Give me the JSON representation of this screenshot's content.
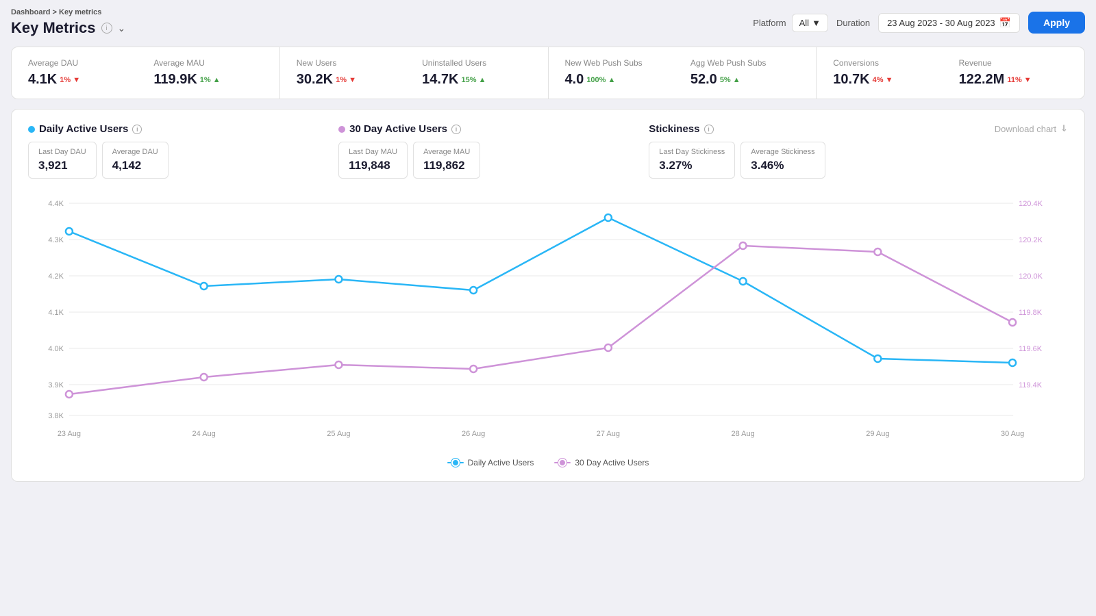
{
  "breadcrumb": {
    "parent": "Dashboard",
    "separator": ">",
    "current": "Key metrics"
  },
  "pageTitle": "Key Metrics",
  "controls": {
    "platform_label": "Platform",
    "platform_value": "All",
    "duration_label": "Duration",
    "duration_value": "23 Aug 2023 - 30 Aug 2023",
    "apply_label": "Apply"
  },
  "metrics": [
    {
      "group": "group1",
      "items": [
        {
          "label": "Average DAU",
          "value": "4.1K",
          "badge": "1%",
          "trend": "down"
        },
        {
          "label": "Average MAU",
          "value": "119.9K",
          "badge": "1%",
          "trend": "up"
        }
      ]
    },
    {
      "group": "group2",
      "items": [
        {
          "label": "New Users",
          "value": "30.2K",
          "badge": "1%",
          "trend": "down"
        },
        {
          "label": "Uninstalled Users",
          "value": "14.7K",
          "badge": "15%",
          "trend": "up"
        }
      ]
    },
    {
      "group": "group3",
      "items": [
        {
          "label": "New Web Push Subs",
          "value": "4.0",
          "badge": "100%",
          "trend": "up"
        },
        {
          "label": "Agg Web Push Subs",
          "value": "52.0",
          "badge": "5%",
          "trend": "up"
        }
      ]
    },
    {
      "group": "group4",
      "items": [
        {
          "label": "Conversions",
          "value": "10.7K",
          "badge": "4%",
          "trend": "down"
        },
        {
          "label": "Revenue",
          "value": "122.2M",
          "badge": "11%",
          "trend": "down"
        }
      ]
    }
  ],
  "chart": {
    "series1": {
      "label": "Daily Active Users",
      "dot_color": "#29b6f6",
      "last_day_label": "Last Day DAU",
      "last_day_value": "3,921",
      "average_label": "Average DAU",
      "average_value": "4,142"
    },
    "series2": {
      "label": "30 Day Active Users",
      "dot_color": "#ce93d8",
      "last_day_label": "Last Day MAU",
      "last_day_value": "119,848",
      "average_label": "Average MAU",
      "average_value": "119,862"
    },
    "stickiness": {
      "label": "Stickiness",
      "last_day_label": "Last Day Stickiness",
      "last_day_value": "3.27%",
      "average_label": "Average Stickiness",
      "average_value": "3.46%"
    },
    "download_label": "Download chart",
    "xAxis": [
      "23 Aug",
      "24 Aug",
      "25 Aug",
      "26 Aug",
      "27 Aug",
      "28 Aug",
      "29 Aug",
      "30 Aug"
    ],
    "yAxisLeft": [
      "4.4K",
      "4.3K",
      "4.2K",
      "4.1K",
      "4.0K",
      "3.9K",
      "3.8K"
    ],
    "yAxisRight": [
      "120.4K",
      "120.2K",
      "120.0K",
      "119.8K",
      "119.6K",
      "119.4K"
    ],
    "dau_points": [
      4320,
      4165,
      4185,
      4155,
      4360,
      4180,
      3960,
      3950
    ],
    "mau_points": [
      119500,
      119580,
      119640,
      119620,
      119720,
      120200,
      120170,
      119840
    ],
    "legend_dau": "Daily Active Users",
    "legend_mau": "30 Day Active Users"
  }
}
